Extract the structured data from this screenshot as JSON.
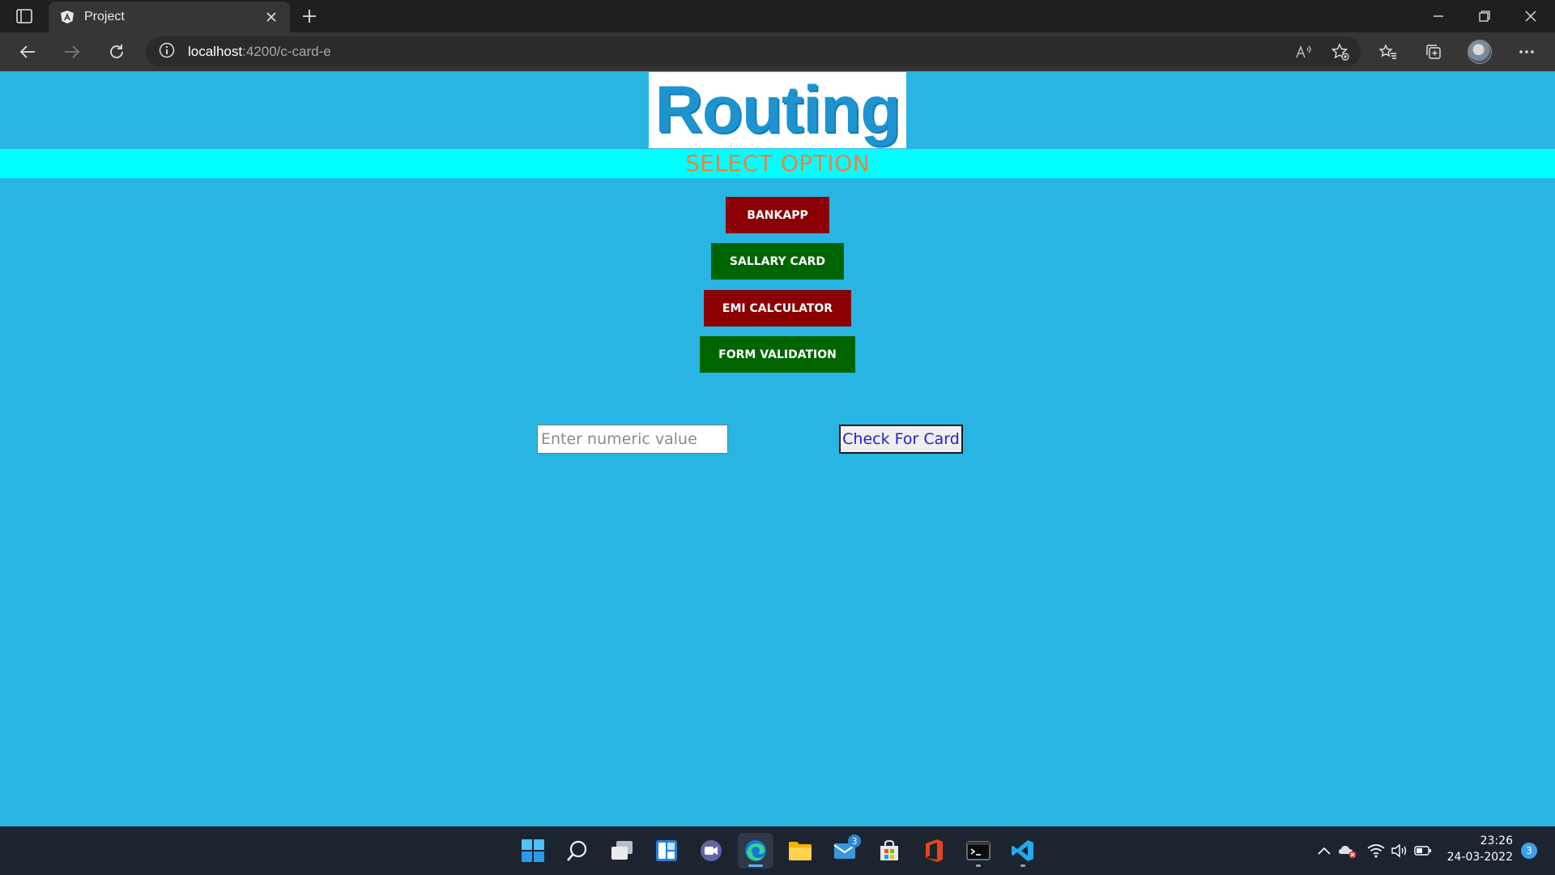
{
  "browser": {
    "tab_title": "Project",
    "favicon_letter": "A",
    "url_host": "localhost",
    "url_path": ":4200/c-card-e"
  },
  "page": {
    "logo_text": "Routing",
    "select_heading": "SELECT OPTION",
    "buttons": [
      {
        "label": "BANKAPP",
        "color": "#8b0000"
      },
      {
        "label": "SALLARY CARD",
        "color": "#006400"
      },
      {
        "label": "EMI CALCULATOR",
        "color": "#8b0000"
      },
      {
        "label": "FORM VALIDATION",
        "color": "#006400"
      }
    ],
    "numeric_input": {
      "placeholder": "Enter numeric value",
      "value": ""
    },
    "check_button_label": "Check For Card",
    "background_color": "#29b5e3",
    "heading_bar_color": "#00ffff"
  },
  "taskbar": {
    "apps": [
      "start-icon",
      "search-icon",
      "task-view-icon",
      "widgets-icon",
      "teams-chat-icon",
      "edge-icon",
      "file-explorer-icon",
      "mail-icon",
      "store-icon",
      "office-icon",
      "terminal-icon",
      "vscode-icon"
    ],
    "mail_badge": "3",
    "time": "23:26",
    "date": "24-03-2022",
    "notification_count": "3"
  }
}
